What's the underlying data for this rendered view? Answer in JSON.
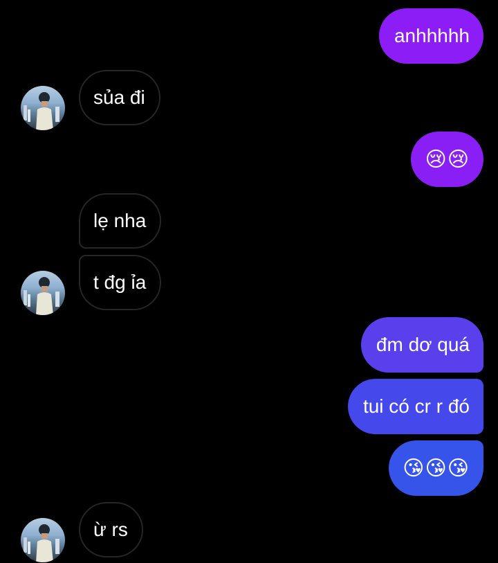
{
  "colors": {
    "background": "#000000",
    "received_border": "#262626",
    "sent_top": "#8c1df6",
    "sent_bottom": "#3754ea",
    "text": "#ffffff"
  },
  "messages": [
    {
      "direction": "sent",
      "text": "anhhhhh"
    },
    {
      "direction": "received",
      "text": "sủa đi"
    },
    {
      "direction": "sent",
      "text": "😢😢",
      "icon": "crying-face-emoji"
    },
    {
      "direction": "received",
      "text": "lẹ nha"
    },
    {
      "direction": "received",
      "text": "t đg ỉa"
    },
    {
      "direction": "sent",
      "text": "đm dơ quá"
    },
    {
      "direction": "sent",
      "text": "tui có cr r đó"
    },
    {
      "direction": "sent",
      "text": "😘😘😘",
      "icon": "kissing-face-emoji"
    },
    {
      "direction": "received",
      "text": "ừ rs"
    }
  ]
}
